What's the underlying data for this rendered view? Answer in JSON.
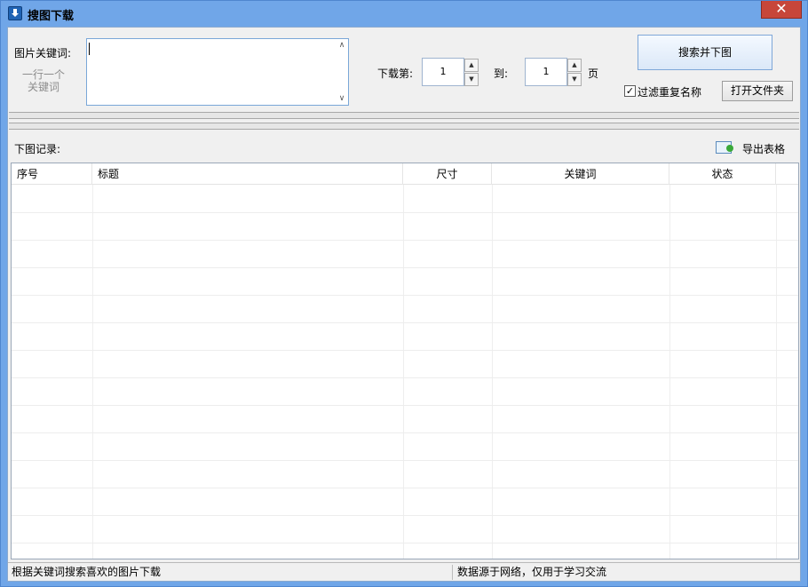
{
  "window": {
    "title": "搜图下载",
    "close_glyph": "✕"
  },
  "keywords": {
    "label": "图片关键词:",
    "hint_line1": "一行一个",
    "hint_line2": "关键词",
    "value": ""
  },
  "pages": {
    "from_label": "下载第:",
    "from_value": "1",
    "to_label": "到:",
    "to_value": "1",
    "unit": "页"
  },
  "actions": {
    "search_download": "搜索并下图",
    "filter_duplicates": "过滤重复名称",
    "filter_checked": "✓",
    "open_folder": "打开文件夹"
  },
  "records": {
    "label": "下图记录:",
    "export": "导出表格"
  },
  "table": {
    "columns": [
      "序号",
      "标题",
      "尺寸",
      "关键词",
      "状态"
    ],
    "rows": []
  },
  "status": {
    "left": "根据关键词搜索喜欢的图片下载",
    "right": "数据源于网络，仅用于学习交流"
  }
}
